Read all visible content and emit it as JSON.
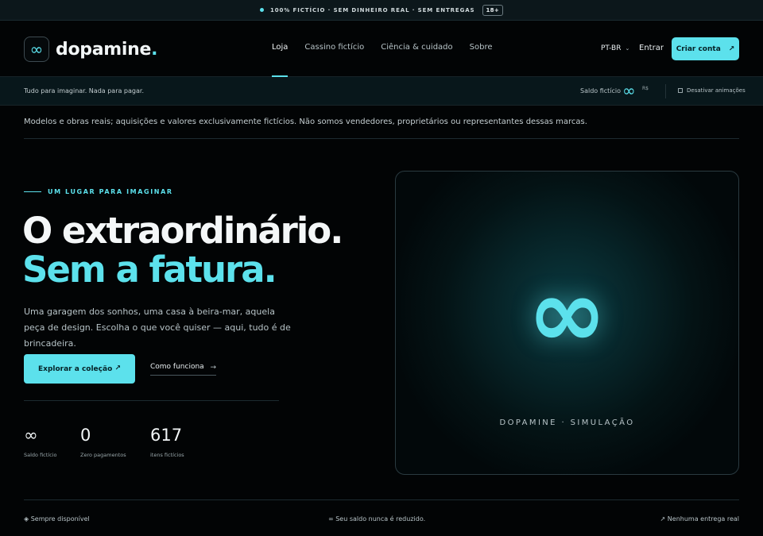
{
  "announcement": {
    "text": "100% FICTÍCIO · SEM DINHEIRO REAL · SEM ENTREGAS",
    "age_badge": "18+"
  },
  "header": {
    "brand": "dopamine",
    "brand_suffix": ".",
    "logo_icon": "infinity-icon",
    "nav": [
      {
        "label": "Loja",
        "active": true
      },
      {
        "label": "Cassino fictício",
        "active": false
      },
      {
        "label": "Ciência & cuidado",
        "active": false
      },
      {
        "label": "Sobre",
        "active": false
      }
    ],
    "language": "PT-BR",
    "login_label": "Entrar",
    "signup_label": "Criar conta",
    "signup_arrow": "↗"
  },
  "subbar": {
    "tagline": "Tudo para imaginar. Nada para pagar.",
    "balance_label": "Saldo fictício",
    "balance_value": "∞",
    "currency": "R$",
    "animation_toggle": "Desativar animações"
  },
  "disclaimer": "Modelos e obras reais; aquisições e valores exclusivamente fictícios. Não somos vendedores, proprietários ou representantes dessas marcas.",
  "hero": {
    "eyebrow": "UM LUGAR PARA IMAGINAR",
    "headline_line1": "O extraordinário.",
    "headline_line2": "Sem a fatura.",
    "lede": "Uma garagem dos sonhos, uma casa à beira-mar, aquela peça de design. Escolha o que você quiser — aqui, tudo é de brincadeira.",
    "primary_cta": "Explorar a coleção",
    "primary_cta_arrow": "↗",
    "secondary_cta": "Como funciona",
    "secondary_cta_arrow": "→",
    "stats": [
      {
        "value": "∞",
        "label": "Saldo fictício"
      },
      {
        "value": "0",
        "label": "Zero pagamentos"
      },
      {
        "value": "617",
        "label": "itens fictícios"
      }
    ],
    "card_symbol": "∞",
    "card_caption": "DOPAMINE · SIMULAÇÃO"
  },
  "footer": {
    "left": "◈ Sempre disponível",
    "center": "∞ Seu saldo nunca é reduzido.",
    "right": "↗ Nenhuma entrega real"
  },
  "colors": {
    "accent": "#5ce1ec",
    "background": "#020405"
  }
}
